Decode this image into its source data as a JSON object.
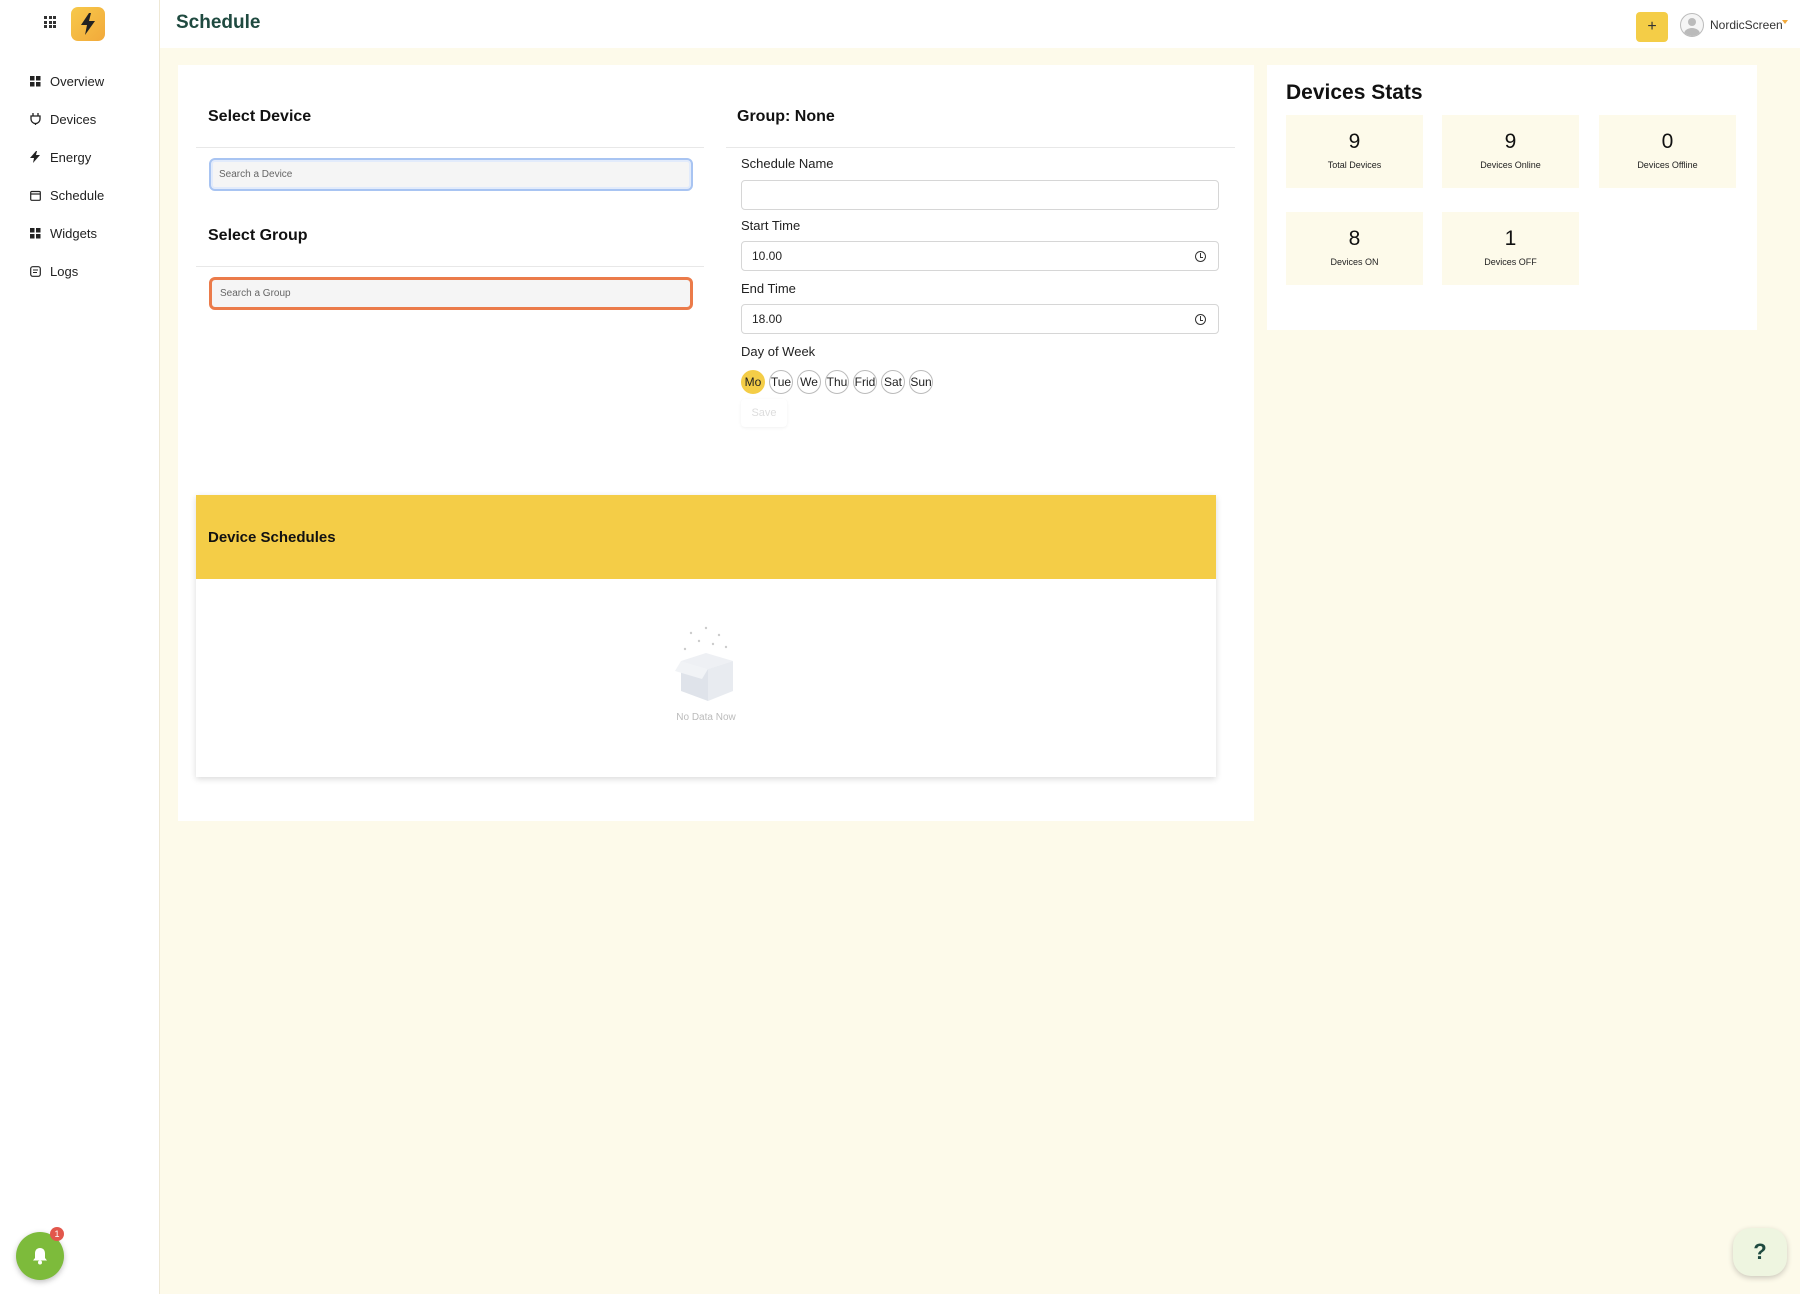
{
  "header": {
    "title": "Schedule",
    "add_label": "+",
    "user_name": "NordicScreen"
  },
  "sidebar": {
    "items": [
      {
        "label": "Overview",
        "icon": "dashboard-icon"
      },
      {
        "label": "Devices",
        "icon": "plug-icon"
      },
      {
        "label": "Energy",
        "icon": "bolt-icon"
      },
      {
        "label": "Schedule",
        "icon": "calendar-icon"
      },
      {
        "label": "Widgets",
        "icon": "widgets-icon"
      },
      {
        "label": "Logs",
        "icon": "logs-icon"
      }
    ],
    "notification_count": "1"
  },
  "device_select": {
    "title": "Select Device",
    "placeholder": "Search a Device"
  },
  "group_select": {
    "title": "Select Group",
    "placeholder": "Search a Group"
  },
  "form": {
    "group_title": "Group: None",
    "schedule_name_label": "Schedule Name",
    "schedule_name_value": "",
    "start_label": "Start Time",
    "start_value": "10.00",
    "end_label": "End Time",
    "end_value": "18.00",
    "day_label": "Day of Week",
    "days": [
      "Mo",
      "Tue",
      "We",
      "Thu",
      "Frid",
      "Sat",
      "Sun"
    ],
    "selected_day": "Mo",
    "save_label": "Save"
  },
  "schedules": {
    "title": "Device Schedules",
    "empty_text": "No Data Now"
  },
  "stats": {
    "title": "Devices Stats",
    "items": [
      {
        "value": "9",
        "label": "Total Devices"
      },
      {
        "value": "9",
        "label": "Devices Online"
      },
      {
        "value": "0",
        "label": "Devices Offline"
      },
      {
        "value": "8",
        "label": "Devices ON"
      },
      {
        "value": "1",
        "label": "Devices OFF"
      }
    ]
  },
  "help_label": "?",
  "colors": {
    "accent": "#f4cd47",
    "background": "#fdfaea",
    "title": "#1f4a40",
    "notification": "#7dbb3b"
  }
}
